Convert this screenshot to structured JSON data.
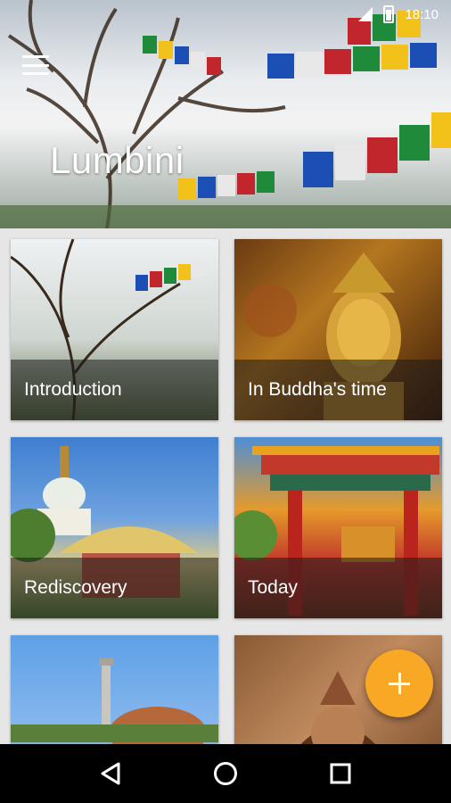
{
  "status_bar": {
    "time": "18:10"
  },
  "header": {
    "title": "Lumbini"
  },
  "cards": [
    {
      "label": "Introduction"
    },
    {
      "label": "In Buddha's time"
    },
    {
      "label": "Rediscovery"
    },
    {
      "label": "Today"
    },
    {
      "label": ""
    },
    {
      "label": ""
    }
  ],
  "colors": {
    "fab": "#f9a825",
    "label_overlay": "rgba(25,25,25,0.55)",
    "nav_bar": "#000000"
  },
  "icons": {
    "menu": "hamburger-menu-icon",
    "fab": "plus-icon",
    "back": "back-triangle-icon",
    "home": "home-circle-icon",
    "recents": "recents-square-icon"
  }
}
